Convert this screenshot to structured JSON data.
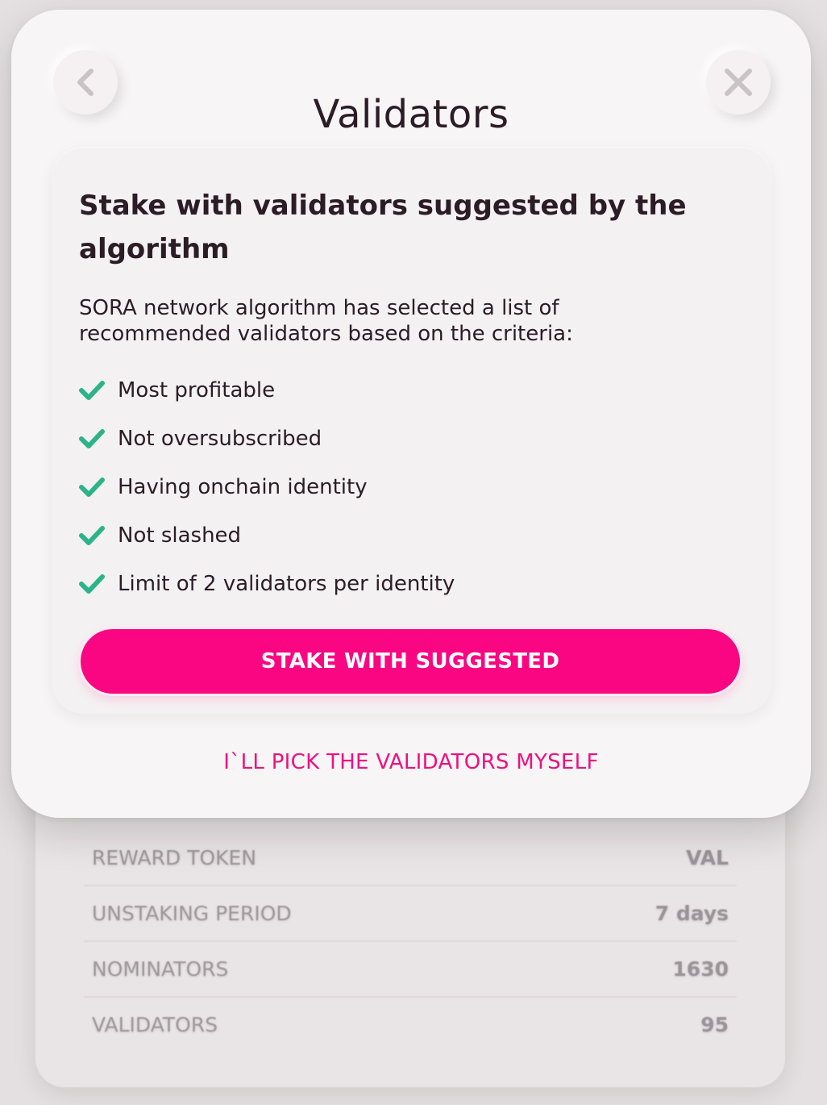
{
  "modal": {
    "title": "Validators",
    "back_icon": "chevron-left-icon",
    "close_icon": "close-icon"
  },
  "card": {
    "heading": "Stake with validators suggested by the algorithm",
    "description": "SORA network algorithm has selected a list of recommended validators based on the criteria:",
    "criteria": [
      "Most profitable",
      "Not oversubscribed",
      "Having onchain identity",
      "Not slashed",
      "Limit of 2 validators per identity"
    ],
    "check_icon": "checkmark-icon",
    "check_color": "#2db38a",
    "stake_button_label": "STAKE WITH SUGGESTED"
  },
  "pick_myself_label": "I`LL PICK THE VALIDATORS MYSELF",
  "background_info": {
    "rows": [
      {
        "label": "REWARD TOKEN",
        "value": "VAL"
      },
      {
        "label": "UNSTAKING PERIOD",
        "value": "7 days"
      },
      {
        "label": "NOMINATORS",
        "value": "1630"
      },
      {
        "label": "VALIDATORS",
        "value": "95"
      }
    ]
  },
  "colors": {
    "accent": "#fa0683",
    "link": "#ee117f",
    "text": "#2b1c25"
  }
}
